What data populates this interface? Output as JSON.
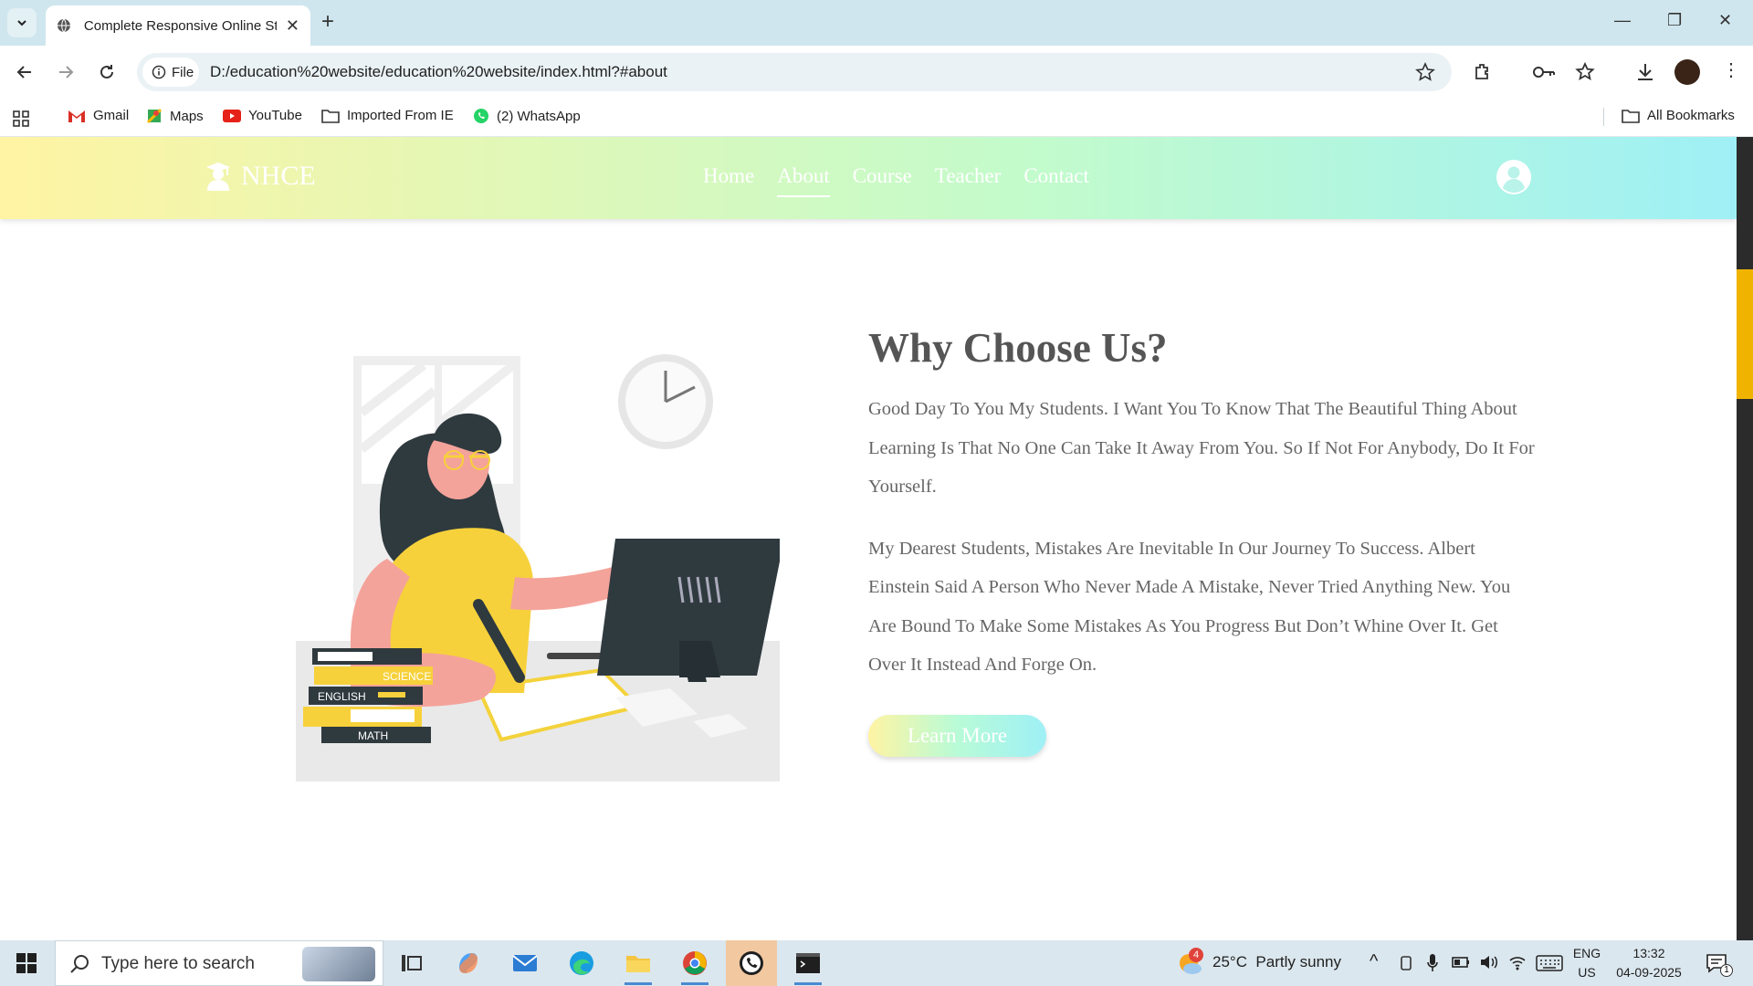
{
  "browser": {
    "tab_title": "Complete Responsive Online St",
    "omnibox_chip": "File",
    "url": "D:/education%20website/education%20website/index.html?#about",
    "bookmarks": [
      {
        "label": "Gmail",
        "icon": "gmail-icon"
      },
      {
        "label": "Maps",
        "icon": "maps-icon"
      },
      {
        "label": "YouTube",
        "icon": "youtube-icon"
      },
      {
        "label": "Imported From IE",
        "icon": "folder-icon"
      },
      {
        "label": "(2) WhatsApp",
        "icon": "whatsapp-icon"
      }
    ],
    "all_bookmarks": "All Bookmarks"
  },
  "site": {
    "logo": "NHCE",
    "nav": [
      {
        "label": "Home",
        "active": false
      },
      {
        "label": "About",
        "active": true
      },
      {
        "label": "Course",
        "active": false
      },
      {
        "label": "Teacher",
        "active": false
      },
      {
        "label": "Contact",
        "active": false
      }
    ],
    "about": {
      "heading": "Why Choose Us?",
      "paragraph1": "Good Day To You My Students. I Want You To Know That The Beautiful Thing About Learning Is That No One Can Take It Away From You. So If Not For Anybody, Do It For Yourself.",
      "paragraph2": "My Dearest Students, Mistakes Are Inevitable In Our Journey To Success. Albert Einstein Said A Person Who Never Made A Mistake, Never Tried Anything New. You Are Bound To Make Some Mistakes As You Progress But Don’t Whine Over It. Get Over It Instead And Forge On.",
      "button": "Learn More"
    },
    "illustration_books": [
      "SCIENCE",
      "ENGLISH",
      "MATH"
    ],
    "colors": {
      "header_start": "#fff4a3",
      "header_mid": "#c2fbcc",
      "header_end": "#9ff0f6",
      "accent_yellow": "#f6d23a"
    }
  },
  "taskbar": {
    "search_placeholder": "Type here to search",
    "weather": "25°C  Partly sunny",
    "weather_badge": "4",
    "lang_top": "ENG",
    "lang_bottom": "US",
    "time": "13:32",
    "date": "04-09-2025",
    "notification_count": "1"
  }
}
